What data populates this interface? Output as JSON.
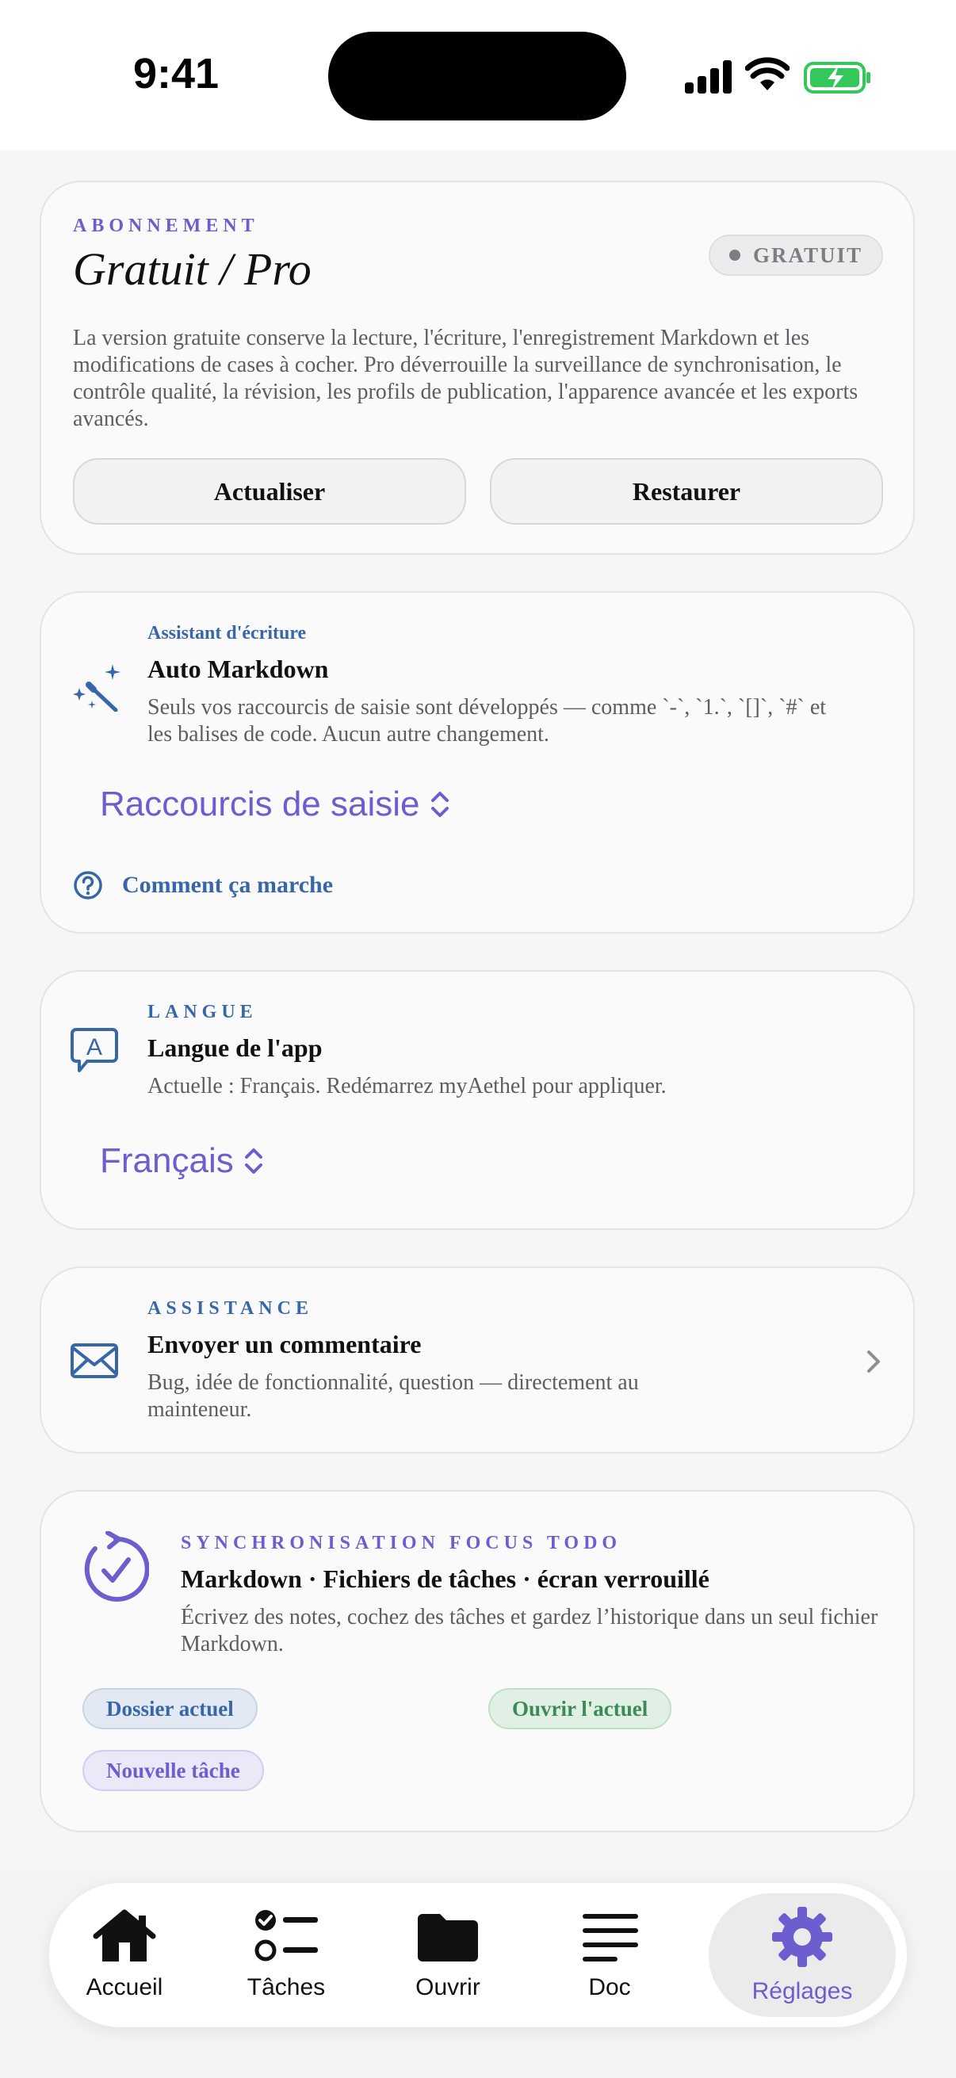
{
  "status_bar": {
    "time": "9:41"
  },
  "subscription": {
    "eyebrow": "ABONNEMENT",
    "title": "Gratuit / Pro",
    "badge": "GRATUIT",
    "description": "La version gratuite conserve la lecture, l'écriture, l'enregistrement Markdown et les modifications de cases à cocher. Pro déverrouille la surveillance de synchronisation, le contrôle qualité, la révision, les profils de publication, l'apparence avancée et les exports avancés.",
    "refresh_label": "Actualiser",
    "restore_label": "Restaurer"
  },
  "assistant": {
    "eyebrow": "Assistant d'écriture",
    "title": "Auto Markdown",
    "description": "Seuls vos raccourcis de saisie sont développés — comme `-`, `1.`, `[]`, `#` et les balises de code. Aucun autre changement.",
    "mode_value": "Raccourcis de saisie",
    "help_label": "Comment ça marche"
  },
  "language": {
    "eyebrow": "LANGUE",
    "title": "Langue de l'app",
    "description": "Actuelle : Français. Redémarrez myAethel pour appliquer.",
    "value": "Français"
  },
  "support": {
    "eyebrow": "ASSISTANCE",
    "title": "Envoyer un commentaire",
    "description": "Bug, idée de fonctionnalité, question — directement au mainteneur."
  },
  "sync": {
    "eyebrow": "SYNCHRONISATION FOCUS TODO",
    "title": "Markdown · Fichiers de tâches · écran verrouillé",
    "description": "Écrivez des notes, cochez des tâches et gardez l’historique dans un seul fichier Markdown.",
    "chips": {
      "current_folder": "Dossier actuel",
      "open_current": "Ouvrir l'actuel",
      "new_task": "Nouvelle tâche"
    }
  },
  "tabbar": {
    "tabs": [
      {
        "label": "Accueil",
        "icon": "house-icon"
      },
      {
        "label": "Tâches",
        "icon": "checklist-icon"
      },
      {
        "label": "Ouvrir",
        "icon": "folder-icon"
      },
      {
        "label": "Doc",
        "icon": "text-lines-icon"
      },
      {
        "label": "Réglages",
        "icon": "gear-icon",
        "active": true
      }
    ]
  },
  "colors": {
    "accent_purple": "#6c5ecf",
    "accent_blue": "#3867a8",
    "accent_green": "#3c8a55",
    "battery_green": "#34c759"
  }
}
